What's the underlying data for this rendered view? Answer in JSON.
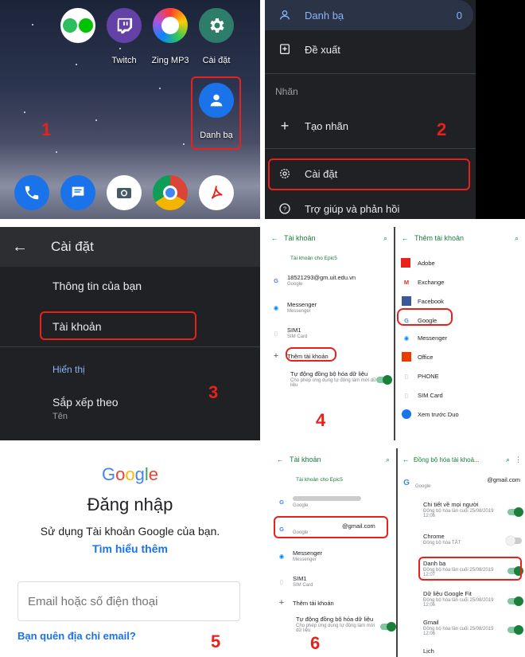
{
  "panel1": {
    "apps_top": [
      {
        "label": "Twitch",
        "color": "#6441a5",
        "icon": "twitch-icon"
      },
      {
        "label": "Zing MP3",
        "color": "#ffffff",
        "icon": "zing-mp3-icon"
      },
      {
        "label": "Cài đặt",
        "color": "#2e7d6b",
        "icon": "gear-icon"
      }
    ],
    "contacts_label": "Danh bạ",
    "step": "1"
  },
  "panel2": {
    "contacts_label": "Danh bạ",
    "contacts_count": "0",
    "suggest_label": "Đề xuất",
    "labels_header": "Nhãn",
    "create_label": "Tạo nhãn",
    "settings_label": "Cài đặt",
    "help_label": "Trợ giúp và phản hồi",
    "step": "2"
  },
  "panel3": {
    "title": "Cài đặt",
    "info": "Thông tin của bạn",
    "accounts": "Tài khoản",
    "display_header": "Hiển thị",
    "sort_by": "Sắp xếp theo",
    "sort_value": "Tên",
    "step": "3"
  },
  "panel4": {
    "left_title": "Tài khoản",
    "section": "Tài khoản cho Epic5",
    "accounts": [
      {
        "name": "18521293@gm.uit.edu.vn",
        "type": "Google"
      },
      {
        "name": "Messenger",
        "type": "Messenger"
      },
      {
        "name": "SIM1",
        "type": "SIM Card"
      }
    ],
    "add_account": "Thêm tài khoản",
    "auto_sync": "Tự động đồng bộ hóa dữ liệu",
    "auto_sync_desc": "Cho phép ứng dụng tự động làm mới dữ liệu",
    "right_title": "Thêm tài khoản",
    "providers": [
      "Adobe",
      "Exchange",
      "Facebook",
      "Google",
      "Messenger",
      "Office",
      "PHONE",
      "SIM Card",
      "Xem trước Duo"
    ],
    "step": "4"
  },
  "panel5": {
    "logo": "Google",
    "title": "Đăng nhập",
    "subtitle": "Sử dụng Tài khoản Google của bạn.",
    "learn_more": "Tìm hiểu thêm",
    "email_placeholder": "Email hoặc số điện thoại",
    "forgot_email": "Bạn quên địa chỉ email?",
    "step": "5"
  },
  "panel6": {
    "left_title": "Tài khoản",
    "section": "Tài khoản cho Epic5",
    "google_type": "Google",
    "gmail": "@gmail.com",
    "messenger": "Messenger",
    "sim_name": "SIM1",
    "sim_type": "SIM Card",
    "add_account": "Thêm tài khoản",
    "auto_sync": "Tự động đồng bộ hóa dữ liệu",
    "auto_sync_desc": "Cho phép ứng dụng tự động làm mới dữ liệu",
    "right_title": "Đồng bộ hóa tài khoả...",
    "right_email": "@gmail.com",
    "right_type": "Google",
    "sync_items": [
      {
        "name": "Chi tiết về mọi người",
        "desc": "Đồng bộ hóa lần cuối 25/08/2019 12:06",
        "on": true
      },
      {
        "name": "Chrome",
        "desc": "Đồng bộ hóa TẮT",
        "on": false
      },
      {
        "name": "Danh bạ",
        "desc": "Đồng bộ hóa lần cuối 25/08/2019 12:07",
        "on": true
      },
      {
        "name": "Dữ liệu Google Fit",
        "desc": "Đồng bộ hóa lần cuối 25/08/2019 12:06",
        "on": true
      },
      {
        "name": "Gmail",
        "desc": "Đồng bộ hóa lần cuối 25/08/2019 12:06",
        "on": true
      }
    ],
    "last_item": "Lịch",
    "step": "6"
  }
}
